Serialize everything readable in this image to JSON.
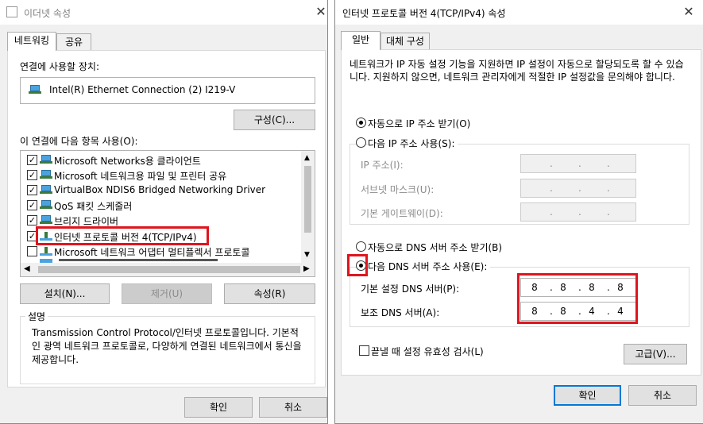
{
  "left_window": {
    "title": "이더넷 속성",
    "tabs": [
      "네트워킹",
      "공유"
    ],
    "connect_using_label": "연결에 사용할 장치:",
    "adapter_name": "Intel(R) Ethernet Connection (2) I219-V",
    "configure_button": "구성(C)...",
    "items_label": "이 연결에 다음 항목 사용(O):",
    "items": [
      {
        "label": "Microsoft Networks용 클라이언트",
        "checked": true
      },
      {
        "label": "Microsoft 네트워크용 파일 및 프린터 공유",
        "checked": true
      },
      {
        "label": "VirtualBox NDIS6 Bridged Networking Driver",
        "checked": true
      },
      {
        "label": "QoS 패킷 스케줄러",
        "checked": true
      },
      {
        "label": "브리지 드라이버",
        "checked": true
      },
      {
        "label": "인터넷 프로토콜 버전 4(TCP/IPv4)",
        "checked": true
      },
      {
        "label": "Microsoft 네트워크 어댑터 멀티플렉서 프로토콜",
        "checked": false
      }
    ],
    "install_button": "설치(N)...",
    "remove_button": "제거(U)",
    "properties_button": "속성(R)",
    "description_label": "설명",
    "description_text": "Transmission Control Protocol/인터넷 프로토콜입니다. 기본적인 광역 네트워크 프로토콜로, 다양하게 연결된 네트워크에서 통신을 제공합니다.",
    "ok_button": "확인",
    "cancel_button": "취소"
  },
  "right_window": {
    "title": "인터넷 프로토콜 버전 4(TCP/IPv4) 속성",
    "tabs": [
      "일반",
      "대체 구성"
    ],
    "intro_text": "네트워크가 IP 자동 설정 기능을 지원하면 IP 설정이 자동으로 할당되도록 할 수 있습니다. 지원하지 않으면, 네트워크 관리자에게 적절한 IP 설정값을 문의해야 합니다.",
    "auto_ip_label": "자동으로 IP 주소 받기(O)",
    "manual_ip_label": "다음 IP 주소 사용(S):",
    "ip_address_label": "IP 주소(I):",
    "subnet_label": "서브넷 마스크(U):",
    "gateway_label": "기본 게이트웨이(D):",
    "auto_dns_label": "자동으로 DNS 서버 주소 받기(B)",
    "manual_dns_label": "다음 DNS 서버 주소 사용(E):",
    "preferred_dns_label": "기본 설정 DNS 서버(P):",
    "preferred_dns": [
      "8",
      "8",
      "8",
      "8"
    ],
    "alternate_dns_label": "보조 DNS 서버(A):",
    "alternate_dns": [
      "8",
      "8",
      "4",
      "4"
    ],
    "validate_label": "끝낼 때 설정 유효성 검사(L)",
    "advanced_button": "고급(V)...",
    "ok_button": "확인",
    "cancel_button": "취소",
    "ip_mode": "auto",
    "dns_mode": "manual"
  },
  "colors": {
    "highlight_box": "#e0141e",
    "default_button_border": "#0078d7"
  }
}
